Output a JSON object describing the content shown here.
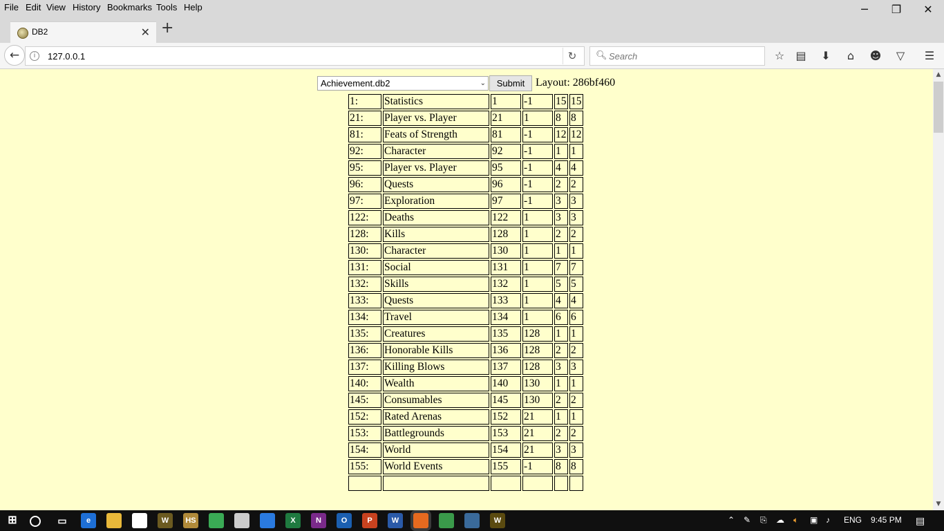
{
  "menu": [
    "File",
    "Edit",
    "View",
    "History",
    "Bookmarks",
    "Tools",
    "Help"
  ],
  "window_controls": {
    "minimize": "─",
    "restore": "❐",
    "close": "✕"
  },
  "tab": {
    "title": "DB2",
    "close": "✕",
    "new_tab": "+"
  },
  "nav": {
    "url": "127.0.0.1",
    "search_placeholder": "Search"
  },
  "controls": {
    "select_value": "Achievement.db2",
    "submit_label": "Submit",
    "layout_text": "Layout: 286bf460"
  },
  "table": {
    "rows": [
      [
        "1:",
        "Statistics",
        "1",
        "-1",
        "15",
        "15"
      ],
      [
        "21:",
        "Player vs. Player",
        "21",
        "1",
        "8",
        "8"
      ],
      [
        "81:",
        "Feats of Strength",
        "81",
        "-1",
        "12",
        "12"
      ],
      [
        "92:",
        "Character",
        "92",
        "-1",
        "1",
        "1"
      ],
      [
        "95:",
        "Player vs. Player",
        "95",
        "-1",
        "4",
        "4"
      ],
      [
        "96:",
        "Quests",
        "96",
        "-1",
        "2",
        "2"
      ],
      [
        "97:",
        "Exploration",
        "97",
        "-1",
        "3",
        "3"
      ],
      [
        "122:",
        "Deaths",
        "122",
        "1",
        "3",
        "3"
      ],
      [
        "128:",
        "Kills",
        "128",
        "1",
        "2",
        "2"
      ],
      [
        "130:",
        "Character",
        "130",
        "1",
        "1",
        "1"
      ],
      [
        "131:",
        "Social",
        "131",
        "1",
        "7",
        "7"
      ],
      [
        "132:",
        "Skills",
        "132",
        "1",
        "5",
        "5"
      ],
      [
        "133:",
        "Quests",
        "133",
        "1",
        "4",
        "4"
      ],
      [
        "134:",
        "Travel",
        "134",
        "1",
        "6",
        "6"
      ],
      [
        "135:",
        "Creatures",
        "135",
        "128",
        "1",
        "1"
      ],
      [
        "136:",
        "Honorable Kills",
        "136",
        "128",
        "2",
        "2"
      ],
      [
        "137:",
        "Killing Blows",
        "137",
        "128",
        "3",
        "3"
      ],
      [
        "140:",
        "Wealth",
        "140",
        "130",
        "1",
        "1"
      ],
      [
        "145:",
        "Consumables",
        "145",
        "130",
        "2",
        "2"
      ],
      [
        "152:",
        "Rated Arenas",
        "152",
        "21",
        "1",
        "1"
      ],
      [
        "153:",
        "Battlegrounds",
        "153",
        "21",
        "2",
        "2"
      ],
      [
        "154:",
        "World",
        "154",
        "21",
        "3",
        "3"
      ],
      [
        "155:",
        "World Events",
        "155",
        "-1",
        "8",
        "8"
      ],
      [
        "",
        "",
        "",
        "",
        "",
        ""
      ]
    ]
  },
  "taskbar": {
    "apps": [
      {
        "name": "edge",
        "glyph": "e",
        "color": "#1e6fd6"
      },
      {
        "name": "file-explorer",
        "glyph": "",
        "color": "#e8b83a"
      },
      {
        "name": "store",
        "glyph": "",
        "color": "#ffffff"
      },
      {
        "name": "wow",
        "glyph": "W",
        "color": "#6b5a20"
      },
      {
        "name": "hearthstone",
        "glyph": "HS",
        "color": "#b08a3a"
      },
      {
        "name": "app-green",
        "glyph": "",
        "color": "#3aaa55"
      },
      {
        "name": "app-tool",
        "glyph": "",
        "color": "#cccccc"
      },
      {
        "name": "teamviewer",
        "glyph": "",
        "color": "#2a7adf"
      },
      {
        "name": "excel",
        "glyph": "X",
        "color": "#1f7a40"
      },
      {
        "name": "onenote",
        "glyph": "N",
        "color": "#7a2a8a"
      },
      {
        "name": "outlook",
        "glyph": "O",
        "color": "#1b5fb0"
      },
      {
        "name": "powerpoint",
        "glyph": "P",
        "color": "#c8421f"
      },
      {
        "name": "word",
        "glyph": "W",
        "color": "#2a5aa8"
      },
      {
        "name": "firefox",
        "glyph": "",
        "color": "#e66a1f"
      },
      {
        "name": "app-triangle",
        "glyph": "",
        "color": "#3a9a4a"
      },
      {
        "name": "app-blue",
        "glyph": "",
        "color": "#3a6a9a"
      },
      {
        "name": "wow-2",
        "glyph": "W",
        "color": "#5a4a10"
      }
    ],
    "lang": "ENG",
    "time": "9:45 PM"
  },
  "colors": {
    "page_bg": "#ffffcc",
    "chrome_bg": "#d9d9d9",
    "taskbar_bg": "#101010"
  }
}
